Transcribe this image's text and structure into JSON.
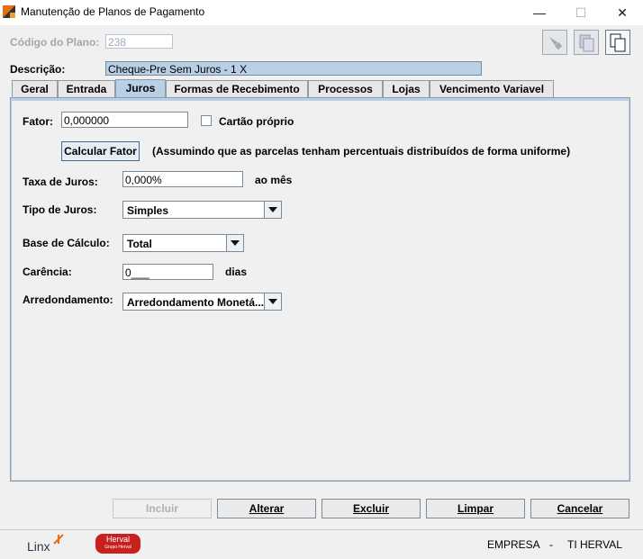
{
  "window": {
    "title": "Manutenção de Planos de Pagamento",
    "minimize": "—",
    "maximize": "☐",
    "close": "✕"
  },
  "codigo": {
    "label": "Código do Plano:",
    "value": "238"
  },
  "descricao": {
    "label": "Descrição:",
    "value": "Cheque-Pre Sem Juros - 1 X"
  },
  "tabs": [
    {
      "label": "Geral"
    },
    {
      "label": "Entrada"
    },
    {
      "label": "Juros"
    },
    {
      "label": "Formas de Recebimento"
    },
    {
      "label": "Processos"
    },
    {
      "label": "Lojas"
    },
    {
      "label": "Vencimento Variavel"
    }
  ],
  "juros": {
    "fator_label": "Fator:",
    "fator_value": "0,000000",
    "cartao_label": "Cartão próprio",
    "calcular_label": "Calcular Fator",
    "calcular_note": "(Assumindo que as parcelas tenham percentuais distribuídos de forma uniforme)",
    "taxa_label": "Taxa de Juros:",
    "taxa_value": "0,000%",
    "taxa_suffix": "ao mês",
    "tipo_label": "Tipo de Juros:",
    "tipo_value": "Simples",
    "base_label": "Base de Cálculo:",
    "base_value": "Total",
    "carencia_label": "Carência:",
    "carencia_value": "0___",
    "carencia_suffix": "dias",
    "arred_label": "Arredondamento:",
    "arred_value": "Arredondamento Monetá..."
  },
  "buttons": {
    "incluir": "Incluir",
    "alterar": "Alterar",
    "excluir": "Excluir",
    "limpar": "Limpar",
    "cancelar": "Cancelar"
  },
  "status": {
    "logo1": "Linx",
    "logo2": "Herval",
    "logo2_sub": "Grupo Herval",
    "empresa": "EMPRESA",
    "sep": "-",
    "company": "TI HERVAL"
  },
  "colors": {
    "accent": "#b8cfe5",
    "linx": "#e76d12",
    "herval": "#c8201e"
  }
}
